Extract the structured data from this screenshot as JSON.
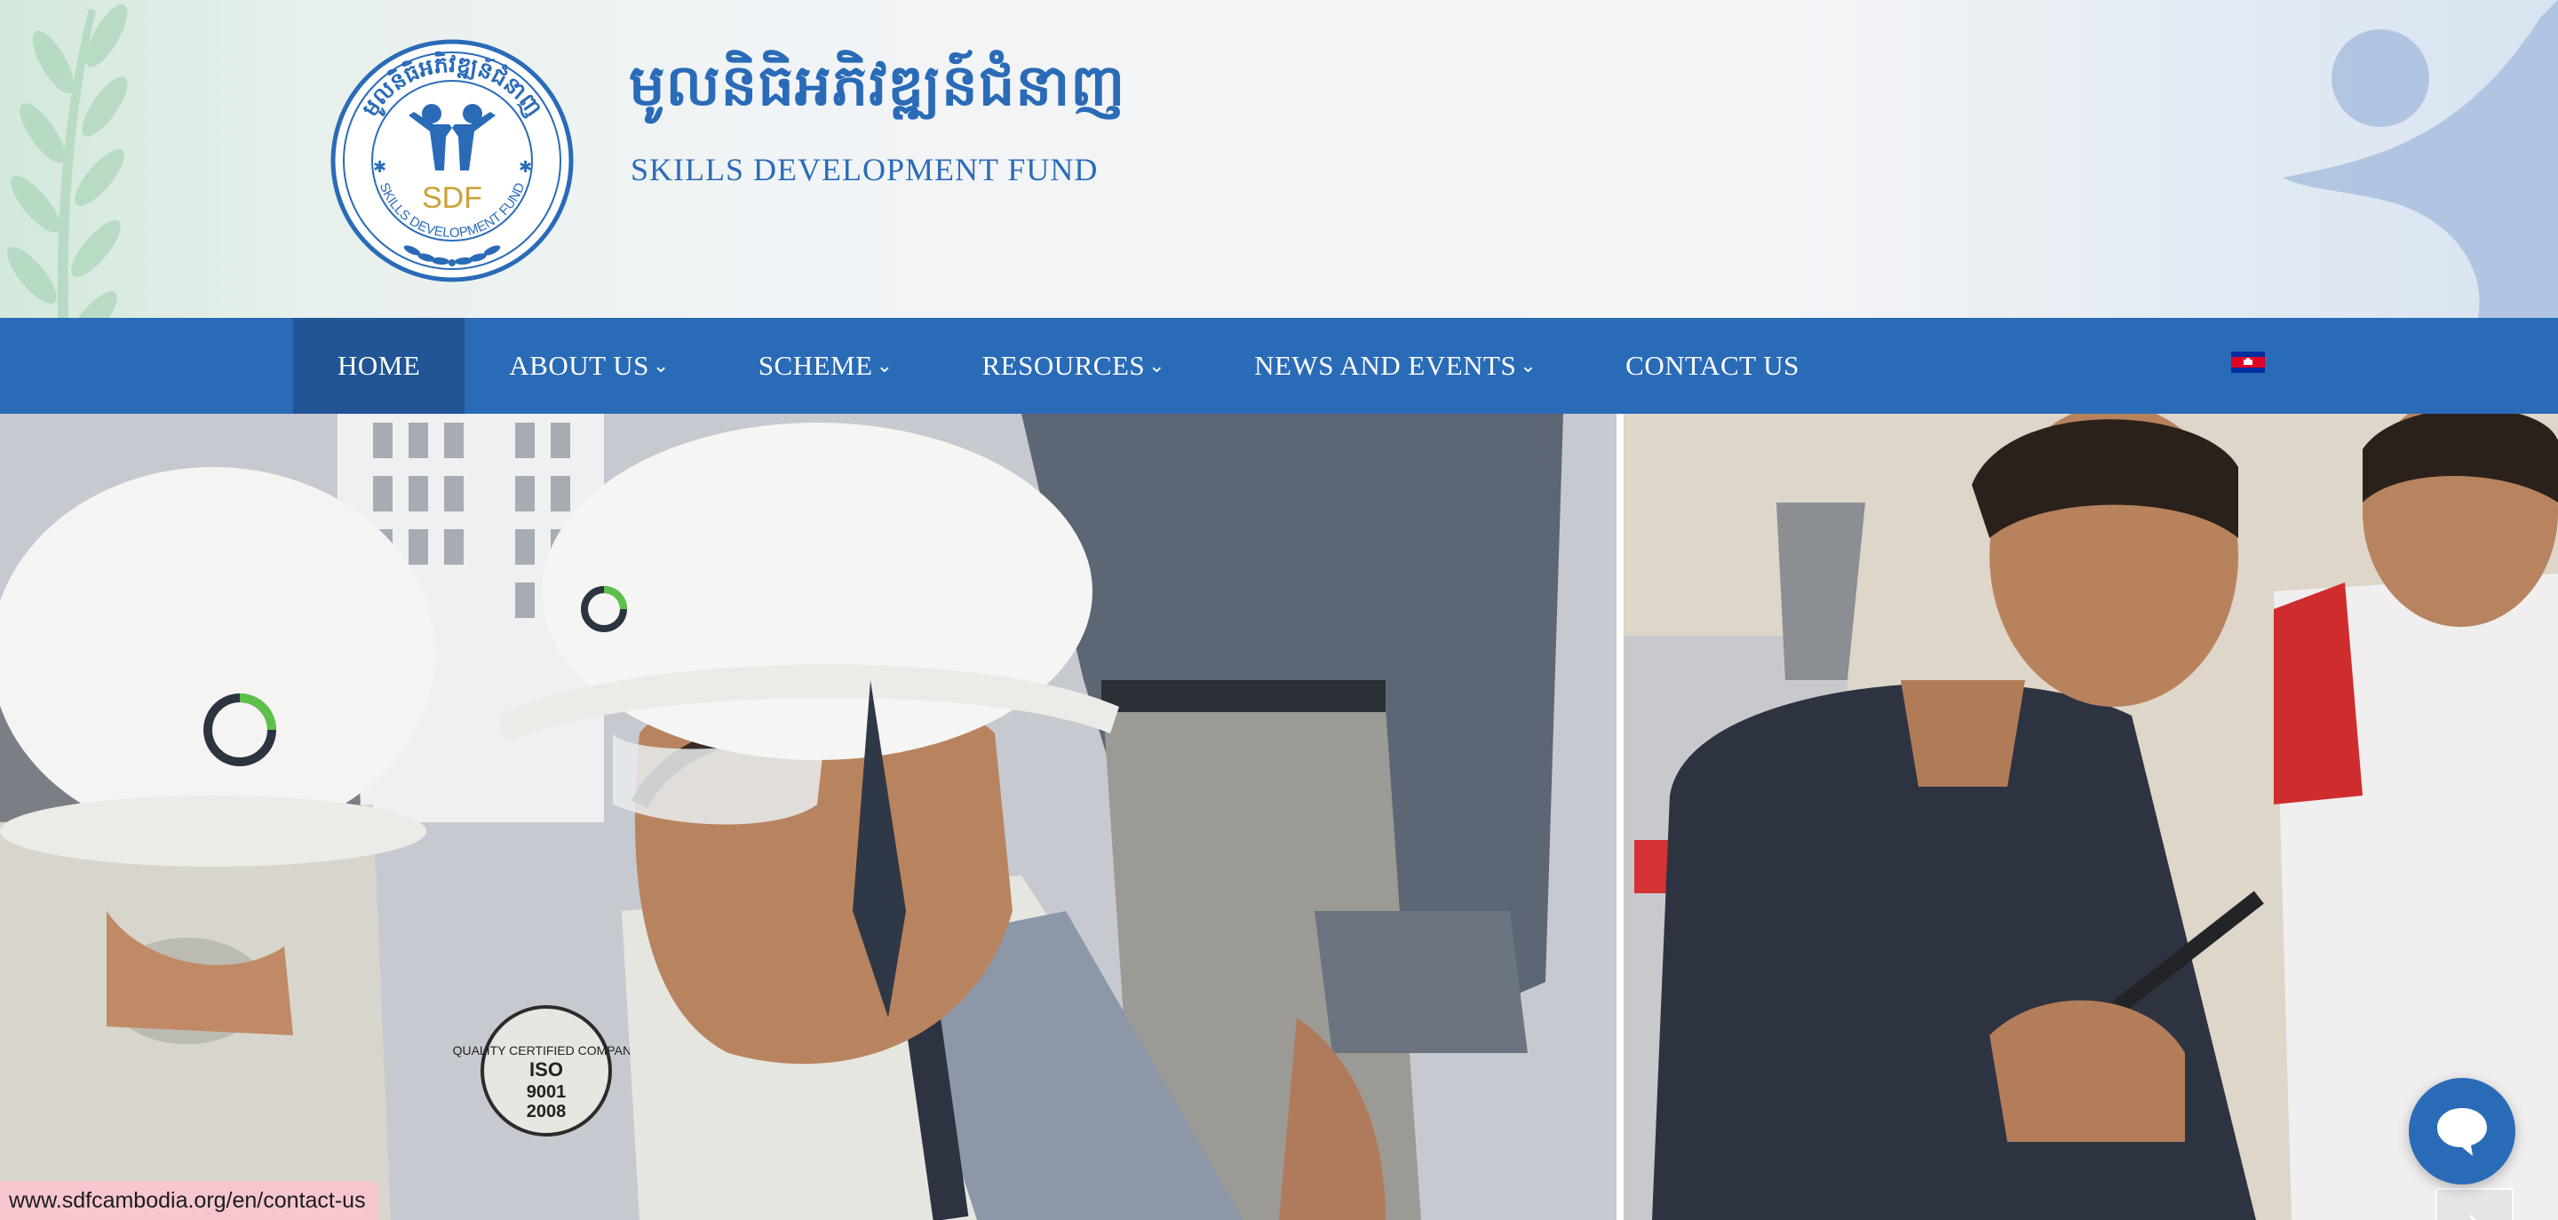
{
  "header": {
    "logo": {
      "ring_text": "មូលនិធិអភិវឌ្ឍន៍ជំនាញ",
      "abbr": "SDF",
      "name": "SKILLS DEVELOPMENT FUND"
    },
    "brand_khmer": "មូលនិធិអភិវឌ្ឍន៍ជំនាញ",
    "brand_english": "SKILLS DEVELOPMENT FUND"
  },
  "nav": {
    "items": [
      {
        "label": "HOME",
        "active": true,
        "has_dropdown": false
      },
      {
        "label": "ABOUT US",
        "active": false,
        "has_dropdown": true
      },
      {
        "label": "SCHEME",
        "active": false,
        "has_dropdown": true
      },
      {
        "label": "RESOURCES",
        "active": false,
        "has_dropdown": true
      },
      {
        "label": "NEWS AND EVENTS",
        "active": false,
        "has_dropdown": true
      },
      {
        "label": "CONTACT US",
        "active": false,
        "has_dropdown": false
      }
    ],
    "language_flag": "cambodia-flag-icon"
  },
  "hero": {
    "prev_icon": "chevron-left-icon",
    "next_icon": "chevron-right-icon",
    "helmet_patch_text": [
      "QUALITY CERTIFIED COMPANY",
      "ISO",
      "9001",
      "2008"
    ]
  },
  "chat": {
    "icon": "chat-bubble-icon"
  },
  "status_bar": {
    "url": "www.sdfcambodia.org/en/contact-us"
  },
  "colors": {
    "brand_blue": "#2a6bb8",
    "nav_active": "#215596",
    "logo_gold": "#c9a23a",
    "status_bar_bg": "#f6c7cf"
  }
}
